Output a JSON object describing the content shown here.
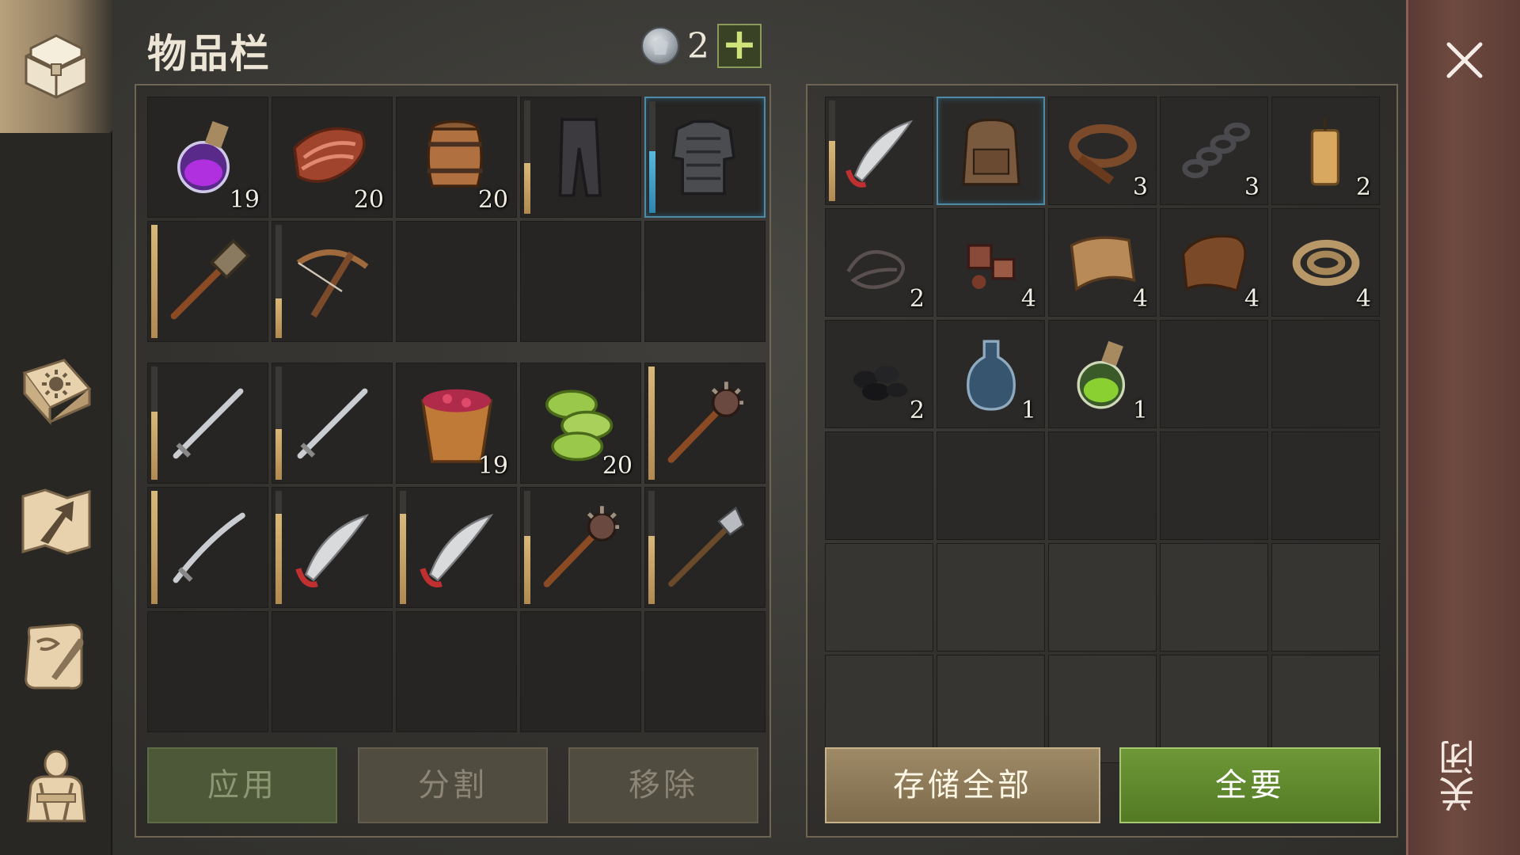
{
  "title": "物品栏",
  "currency": {
    "icon": "silver-coin-icon",
    "count": "2",
    "add_label": "+"
  },
  "colors": {
    "take_all": "#6e9838",
    "store_all": "#9e8a66",
    "selected_border": "#4e8aa6",
    "durability": "#d8b878"
  },
  "nav": [
    {
      "name": "chest-icon",
      "active": true
    },
    {
      "name": "sun-book-icon",
      "active": false
    },
    {
      "name": "map-arrow-icon",
      "active": false
    },
    {
      "name": "scroll-quill-icon",
      "active": false
    },
    {
      "name": "character-icon",
      "active": false
    }
  ],
  "inventory": {
    "slots": [
      {
        "item": "purple-potion",
        "qty": "19"
      },
      {
        "item": "raw-meat",
        "qty": "20"
      },
      {
        "item": "barrel",
        "qty": "20"
      },
      {
        "item": "leather-pants",
        "durability": 0.45
      },
      {
        "item": "chainmail-armor",
        "durability": 0.55,
        "selected": true,
        "bar": "blue"
      },
      {
        "item": "torch-hammer",
        "durability": 1.0
      },
      {
        "item": "crossbow",
        "durability": 0.35
      },
      {
        "item": ""
      },
      {
        "item": ""
      },
      {
        "item": ""
      }
    ],
    "slots_b": [
      {
        "item": "sword",
        "durability": 0.6
      },
      {
        "item": "sword",
        "durability": 0.45
      },
      {
        "item": "berry-bucket",
        "qty": "19"
      },
      {
        "item": "green-melon-slices",
        "qty": "20"
      },
      {
        "item": "spiked-mace",
        "durability": 1.0
      },
      {
        "item": "katana",
        "durability": 1.0
      },
      {
        "item": "scimitar",
        "durability": 0.8
      },
      {
        "item": "scimitar",
        "durability": 0.8
      },
      {
        "item": "spiked-mace",
        "durability": 0.6
      },
      {
        "item": "halberd",
        "durability": 0.6
      },
      {
        "item": ""
      },
      {
        "item": ""
      },
      {
        "item": ""
      },
      {
        "item": ""
      },
      {
        "item": ""
      }
    ]
  },
  "container": {
    "slots": [
      {
        "item": "scimitar",
        "durability": 0.6
      },
      {
        "item": "backpack",
        "selected": true
      },
      {
        "item": "leather-strap",
        "qty": "3"
      },
      {
        "item": "chain",
        "qty": "3"
      },
      {
        "item": "candle",
        "qty": "2"
      },
      {
        "item": "wire",
        "qty": "2"
      },
      {
        "item": "scrap-parts",
        "qty": "4"
      },
      {
        "item": "cloth",
        "qty": "4"
      },
      {
        "item": "leather",
        "qty": "4"
      },
      {
        "item": "rope",
        "qty": "4"
      },
      {
        "item": "coal",
        "qty": "2"
      },
      {
        "item": "empty-bottle",
        "qty": "1"
      },
      {
        "item": "green-potion",
        "qty": "1"
      },
      {
        "item": ""
      },
      {
        "item": ""
      },
      {
        "item": ""
      },
      {
        "item": ""
      },
      {
        "item": ""
      },
      {
        "item": ""
      },
      {
        "item": ""
      },
      {
        "item": "",
        "dim": true
      },
      {
        "item": "",
        "dim": true
      },
      {
        "item": "",
        "dim": true
      },
      {
        "item": "",
        "dim": true
      },
      {
        "item": "",
        "dim": true
      },
      {
        "item": "",
        "dim": true
      },
      {
        "item": "",
        "dim": true
      },
      {
        "item": "",
        "dim": true
      },
      {
        "item": "",
        "dim": true
      },
      {
        "item": "",
        "dim": true
      }
    ]
  },
  "buttons": {
    "apply": "应用",
    "split": "分割",
    "remove": "移除",
    "store_all": "存储全部",
    "take_all": "全要"
  },
  "close": {
    "label": "关闭",
    "icon": "close-icon"
  }
}
